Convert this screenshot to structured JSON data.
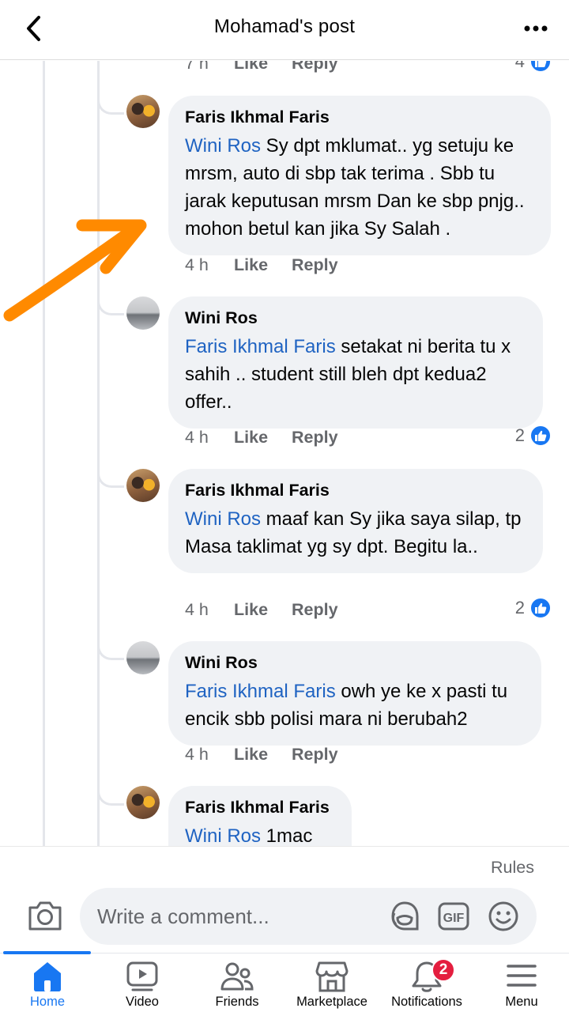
{
  "header": {
    "title": "Mohamad's post"
  },
  "previous_meta": {
    "time": "7 h",
    "like": "Like",
    "reply": "Reply",
    "reactions": "4"
  },
  "comments": [
    {
      "author": "Faris Ikhmal Faris",
      "mention": "Wini Ros",
      "text": " Sy dpt mklumat.. yg setuju ke mrsm, auto di sbp tak terima . Sbb tu jarak keputusan mrsm Dan ke sbp pnjg.. mohon betul kan jika Sy Salah .",
      "time": "4 h",
      "like": "Like",
      "reply": "Reply",
      "reactions": ""
    },
    {
      "author": "Wini Ros",
      "mention": "Faris Ikhmal Faris",
      "text": " setakat ni berita tu x sahih .. student still bleh dpt kedua2 offer..",
      "time": "4 h",
      "like": "Like",
      "reply": "Reply",
      "reactions": "2"
    },
    {
      "author": "Faris Ikhmal Faris",
      "mention": "Wini Ros",
      "text": " maaf kan Sy jika saya silap, tp Masa taklimat yg sy dpt. Begitu la..",
      "time": "4 h",
      "like": "Like",
      "reply": "Reply",
      "reactions": "2"
    },
    {
      "author": "Wini Ros",
      "mention": "Faris Ikhmal Faris",
      "text": " owh ye ke x pasti tu encik sbb polisi mara ni berubah2",
      "time": "4 h",
      "like": "Like",
      "reply": "Reply",
      "reactions": ""
    },
    {
      "author": "Faris Ikhmal Faris",
      "mention": "Wini Ros",
      "text": " 1mac"
    }
  ],
  "composer": {
    "rules": "Rules",
    "placeholder": "Write a comment..."
  },
  "nav": {
    "items": [
      {
        "label": "Home",
        "icon": "home-icon"
      },
      {
        "label": "Video",
        "icon": "video-icon"
      },
      {
        "label": "Friends",
        "icon": "friends-icon"
      },
      {
        "label": "Marketplace",
        "icon": "marketplace-icon"
      },
      {
        "label": "Notifications",
        "icon": "bell-icon",
        "badge": "2"
      },
      {
        "label": "Menu",
        "icon": "menu-icon"
      }
    ]
  },
  "colors": {
    "accent": "#1877f2",
    "mention": "#1f63c2",
    "bubble": "#f0f2f5",
    "arrow": "#ff8a00",
    "badge": "#e41e3f"
  }
}
